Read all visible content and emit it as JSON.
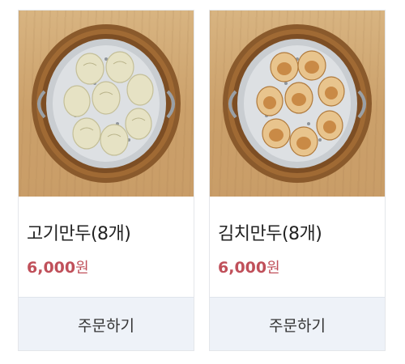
{
  "products": [
    {
      "name": "고기만두(8개)",
      "price": "6,000",
      "currency": "원",
      "order_label": "주문하기",
      "image": "steamed-meat-dumplings-steamer-photo"
    },
    {
      "name": "김치만두(8개)",
      "price": "6,000",
      "currency": "원",
      "order_label": "주문하기",
      "image": "pan-fried-kimchi-dumplings-steamer-photo"
    }
  ]
}
